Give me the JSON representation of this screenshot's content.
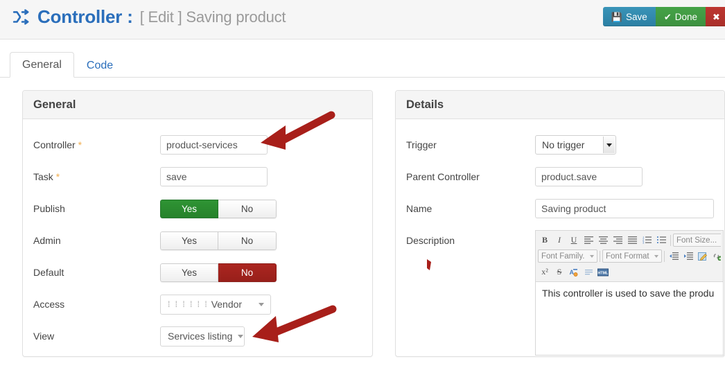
{
  "header": {
    "icon": "shuffle-icon",
    "title": "Controller :",
    "subtitle": "[ Edit ] Saving product",
    "buttons": [
      {
        "label": "Save",
        "icon": "floppy-disk-icon",
        "color": "#2b7fa3"
      },
      {
        "label": "Done",
        "icon": "check-icon",
        "color": "#3d9140"
      },
      {
        "label": "",
        "icon": "close-icon",
        "color": "#a92f2a"
      }
    ]
  },
  "tabs": [
    {
      "label": "General",
      "active": true
    },
    {
      "label": "Code",
      "active": false
    }
  ],
  "general_panel": {
    "title": "General",
    "fields": {
      "controller": {
        "label": "Controller",
        "required": true,
        "value": "product-services"
      },
      "task": {
        "label": "Task",
        "required": true,
        "value": "save"
      },
      "publish": {
        "label": "Publish",
        "yes": "Yes",
        "no": "No",
        "selected": "Yes"
      },
      "admin": {
        "label": "Admin",
        "yes": "Yes",
        "no": "No",
        "selected": ""
      },
      "default": {
        "label": "Default",
        "yes": "Yes",
        "no": "No",
        "selected": "No"
      },
      "access": {
        "label": "Access",
        "value": "Vendor",
        "indent": "⁞ ⁞ ⁞ ⁞ ⁞ ⁞"
      },
      "view": {
        "label": "View",
        "value": "Services listing"
      }
    }
  },
  "details_panel": {
    "title": "Details",
    "fields": {
      "trigger": {
        "label": "Trigger",
        "value": "No trigger"
      },
      "parent_controller": {
        "label": "Parent Controller",
        "value": "product.save"
      },
      "name": {
        "label": "Name",
        "value": "Saving product"
      },
      "description": {
        "label": "Description",
        "value": "This controller is used to save the produ"
      }
    },
    "editor_toolbar": {
      "row1": [
        {
          "name": "bold-icon",
          "glyph": "B"
        },
        {
          "name": "italic-icon",
          "glyph": "I"
        },
        {
          "name": "underline-icon",
          "glyph": "U"
        },
        {
          "name": "align-left-icon",
          "glyph": ""
        },
        {
          "name": "align-center-icon",
          "glyph": ""
        },
        {
          "name": "align-right-icon",
          "glyph": ""
        },
        {
          "name": "align-justify-icon",
          "glyph": ""
        },
        {
          "name": "numbered-list-icon",
          "glyph": ""
        },
        {
          "name": "bullet-list-icon",
          "glyph": ""
        }
      ],
      "font_size": "Font Size...",
      "font_family": "Font Family.",
      "font_format": "Font Format",
      "row2": [
        {
          "name": "outdent-icon"
        },
        {
          "name": "indent-icon"
        },
        {
          "name": "edit-image-icon"
        },
        {
          "name": "unlink-icon"
        },
        {
          "name": "link-icon"
        }
      ],
      "row3": [
        {
          "name": "superscript-icon",
          "glyph": "x²"
        },
        {
          "name": "strikethrough-icon",
          "glyph": "S"
        },
        {
          "name": "remove-format-icon",
          "glyph": "A"
        },
        {
          "name": "horizontal-rule-icon",
          "glyph": ""
        },
        {
          "name": "html-source-icon",
          "glyph": "HTML"
        }
      ]
    }
  },
  "annotations": {
    "arrow_color": "#a81f1a",
    "arrows": [
      {
        "name": "arrow-to-controller-field"
      },
      {
        "name": "arrow-to-view-dropdown"
      }
    ]
  }
}
